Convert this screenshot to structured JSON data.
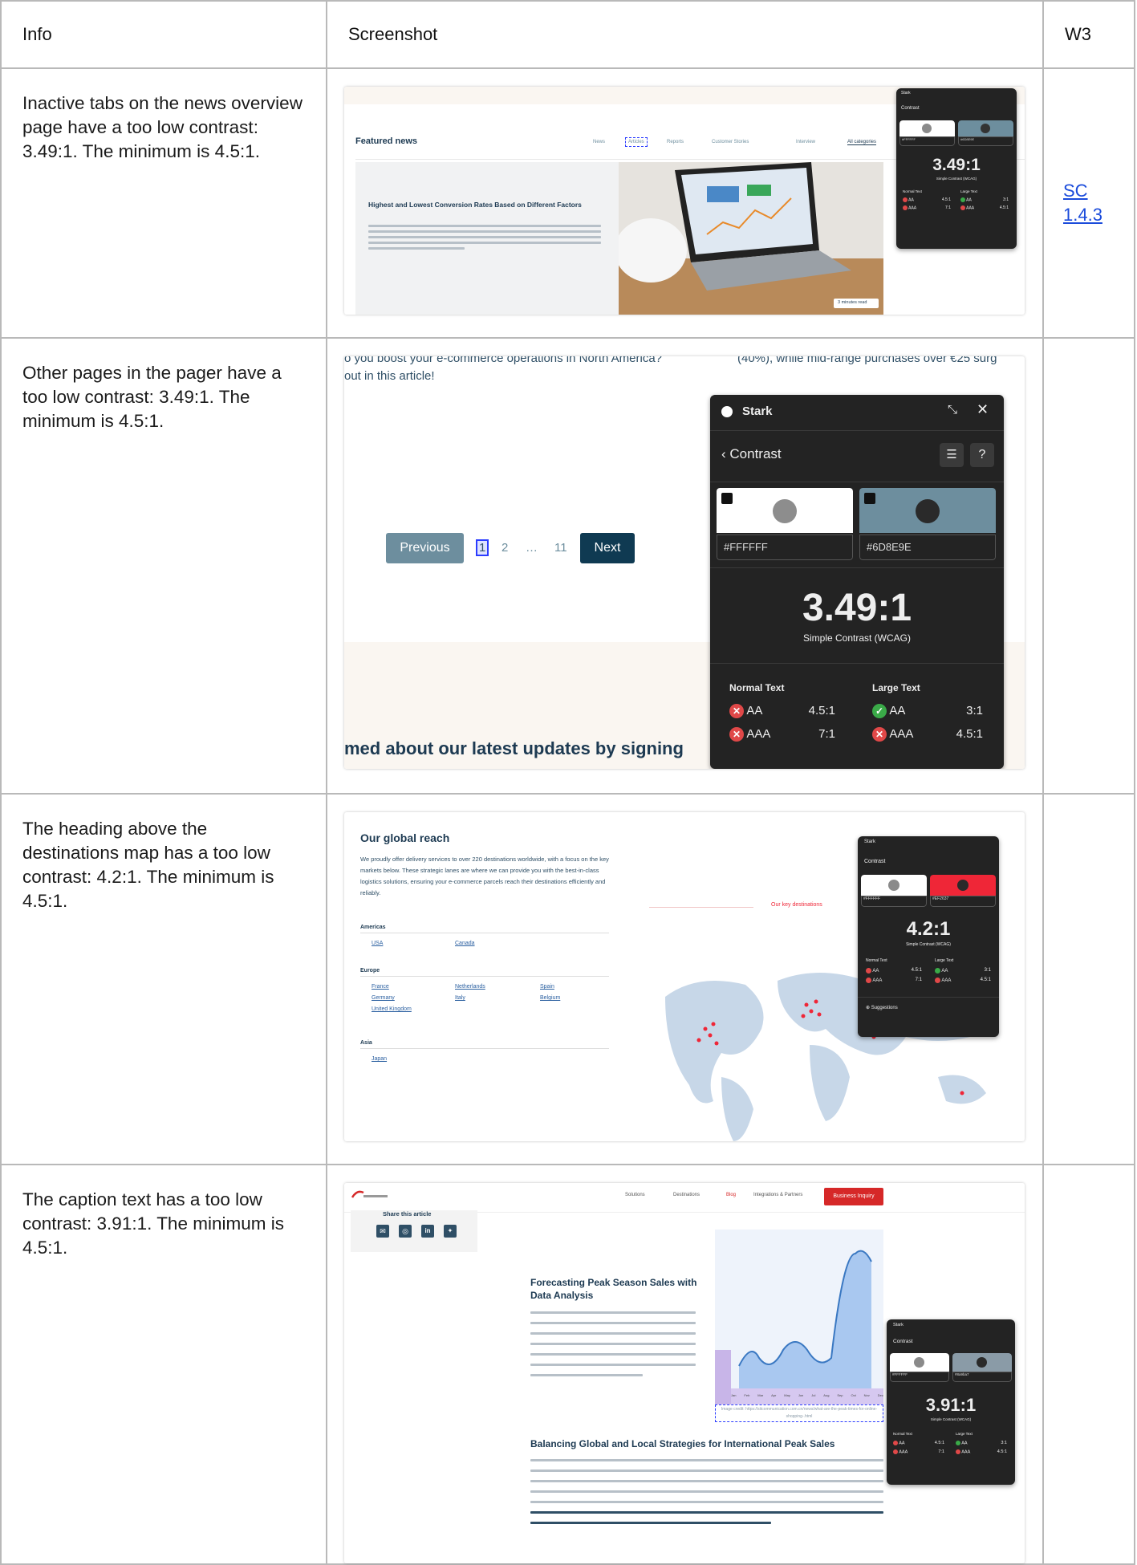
{
  "headers": {
    "info": "Info",
    "screenshot": "Screenshot",
    "w3": "W3"
  },
  "rows": [
    {
      "info": "Inactive tabs on the news overview page have a too low contrast: 3.49:1. The minimum is 4.5:1.",
      "w3_link": "SC 1.4.3",
      "screenshot": {
        "section_title": "Featured news",
        "tabs": [
          "News",
          "Articles",
          "Reports",
          "Customer Stories",
          "Interview",
          "All categories"
        ],
        "article_title": "Highest and Lowest Conversion Rates Based on Different Factors",
        "badge": "3 minutes read",
        "stark": {
          "title": "Stark",
          "back": "Contrast",
          "color1": "#FFFFFF",
          "color2": "#6D8E9E",
          "ratio": "3.49:1",
          "subtitle": "Simple Contrast (WCAG)",
          "normal": "Normal Text",
          "large": "Large Text",
          "aa": "AA",
          "aaa": "AAA",
          "aa_normal": "4.5:1",
          "aaa_normal": "7:1",
          "aa_large": "3:1",
          "aaa_large": "4.5:1"
        }
      }
    },
    {
      "info": "Other pages in the pager have a too low contrast: 3.49:1. The minimum is 4.5:1.",
      "screenshot": {
        "top_text_left_1": "o you boost your e-commerce operations in North America?",
        "top_text_left_2": "out in this article!",
        "top_text_right": "(40%), while mid-range purchases over €25 surg",
        "pager": {
          "previous": "Previous",
          "current": "1",
          "p2": "2",
          "ellipsis": "…",
          "last": "11",
          "next": "Next"
        },
        "bottom_heading": "med about our latest updates by signing",
        "stark": {
          "title": "Stark",
          "back": "Contrast",
          "color1": "#FFFFFF",
          "color2": "#6D8E9E",
          "ratio": "3.49:1",
          "subtitle": "Simple Contrast (WCAG)",
          "normal": "Normal Text",
          "large": "Large Text",
          "aa": "AA",
          "aaa": "AAA",
          "aa_normal": "4.5:1",
          "aaa_normal": "7:1",
          "aa_large": "3:1",
          "aaa_large": "4.5:1"
        }
      }
    },
    {
      "info": "The heading above the destinations map has a too low contrast: 4.2:1. The minimum is 4.5:1.",
      "screenshot": {
        "title": "Our global reach",
        "intro": "We proudly offer delivery services to over 220 destinations worldwide, with a focus on the key markets below. These strategic lanes are where we can provide you with the best-in-class logistics solutions, ensuring your e-commerce parcels reach their destinations efficiently and reliably.",
        "regions": [
          {
            "name": "Americas",
            "countries": [
              "USA",
              "Canada"
            ]
          },
          {
            "name": "Europe",
            "countries": [
              "France",
              "Netherlands",
              "Spain",
              "Germany",
              "Italy",
              "Belgium",
              "United Kingdom"
            ]
          },
          {
            "name": "Asia",
            "countries": [
              "Japan"
            ]
          }
        ],
        "map_heading": "Our key destinations",
        "stark": {
          "title": "Stark",
          "back": "Contrast",
          "color1": "#FFFFFF",
          "color2": "#EF2637",
          "ratio": "4.2:1",
          "subtitle": "Simple Contrast (WCAG)",
          "normal": "Normal Text",
          "large": "Large Text",
          "aa": "AA",
          "aaa": "AAA",
          "aa_normal": "4.5:1",
          "aaa_normal": "7:1",
          "aa_large": "3:1",
          "aaa_large": "4.5:1",
          "suggestions": "Suggestions"
        }
      }
    },
    {
      "info": "The caption text has a too low contrast: 3.91:1. The minimum is 4.5:1.",
      "screenshot": {
        "nav": [
          "Solutions",
          "Destinations",
          "Blog",
          "Integrations & Partners"
        ],
        "cta": "Business Inquiry",
        "share": "Share this article",
        "h1": "Forecasting Peak Season Sales with Data Analysis",
        "caption": "Image credit: https://sitcommunication.com.cn/news/what-are-the-peak-times-for-online-shopping-.html",
        "h2": "Balancing Global and Local Strategies for International Peak Sales",
        "months": [
          "Jan",
          "Feb",
          "Mar",
          "Apr",
          "May",
          "Jun",
          "Jul",
          "Aug",
          "Sep",
          "Oct",
          "Nov",
          "Dec"
        ],
        "stark": {
          "title": "Stark",
          "back": "Contrast",
          "color1": "#FFFFFF",
          "color2": "#8a9ba7",
          "ratio": "3.91:1",
          "subtitle": "Simple Contrast (WCAG)",
          "normal": "Normal Text",
          "large": "Large Text",
          "aa": "AA",
          "aaa": "AAA",
          "aa_normal": "4.5:1",
          "aaa_normal": "7:1",
          "aa_large": "3:1",
          "aaa_large": "4.5:1"
        }
      }
    }
  ]
}
